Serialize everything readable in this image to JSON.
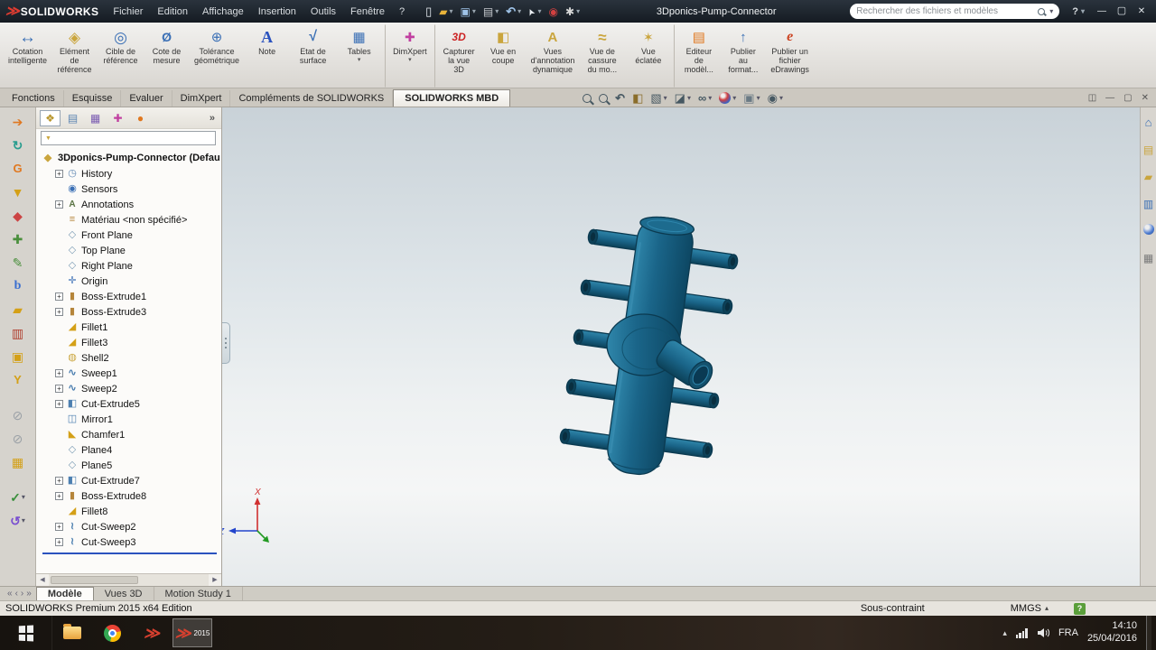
{
  "glyphs": {
    "plus": "+"
  },
  "titlebar": {
    "app_name": "SOLIDWORKS",
    "menus": [
      "Fichier",
      "Edition",
      "Affichage",
      "Insertion",
      "Outils",
      "Fenêtre",
      "?"
    ],
    "quick_icons": [
      {
        "icon": "new-file-icon"
      },
      {
        "icon": "open-folder-icon",
        "caret": "has-caret"
      },
      {
        "icon": "save-icon",
        "caret": "has-caret"
      },
      {
        "icon": "print-icon",
        "caret": "has-caret"
      },
      {
        "icon": "undo-icon",
        "caret": "has-caret"
      },
      {
        "icon": "select-cursor-icon",
        "caret": "has-caret"
      },
      {
        "icon": "rebuild-icon"
      },
      {
        "icon": "options-gear-icon",
        "caret": "has-caret"
      }
    ],
    "doc_title": "3Dponics-Pump-Connector",
    "search_placeholder": "Rechercher des fichiers et modèles",
    "help_label": "?",
    "window_controls": [
      {
        "icon": "minimize-icon"
      },
      {
        "icon": "maximize-icon"
      },
      {
        "icon": "close-icon"
      }
    ]
  },
  "ribbon": {
    "buttons": [
      {
        "label": "Cotation\nintelligente",
        "icon": "smart-dimension-icon"
      },
      {
        "label": "Elément\nde\nréférence",
        "icon": "reference-geometry-icon"
      },
      {
        "label": "Cible de\nréférence",
        "icon": "datum-target-icon"
      },
      {
        "label": "Cote de\nmesure",
        "icon": "measure-dimension-icon"
      },
      {
        "label": "Tolérance\ngéométrique",
        "icon": "geometric-tolerance-icon"
      },
      {
        "label": "Note",
        "icon": "note-icon"
      },
      {
        "label": "Etat de\nsurface",
        "icon": "surface-finish-icon"
      },
      {
        "label": "Tables",
        "icon": "tables-icon",
        "caret": "has-caret"
      },
      {
        "label": "DimXpert",
        "icon": "dimxpert-icon",
        "caret": "has-caret",
        "sep": "group-start"
      },
      {
        "label": "Capturer\nla vue\n3D",
        "icon": "capture-3d-view-icon",
        "sep": "group-start"
      },
      {
        "label": "Vue en\ncoupe",
        "icon": "section-view-icon"
      },
      {
        "label": "Vues\nd'annotation\ndynamique",
        "icon": "dynamic-annotation-icon"
      },
      {
        "label": "Vue de\ncassure\ndu mo...",
        "icon": "break-view-icon"
      },
      {
        "label": "Vue\néclatée",
        "icon": "exploded-view-icon"
      },
      {
        "label": "Editeur\nde\nmodèl...",
        "icon": "model-editor-icon",
        "sep": "group-start"
      },
      {
        "label": "Publier\nau\nformat...",
        "icon": "publish-format-icon"
      },
      {
        "label": "Publier un\nfichier\neDrawings",
        "icon": "edrawings-icon"
      }
    ]
  },
  "tabstrip": {
    "tabs": [
      {
        "label": "Fonctions"
      },
      {
        "label": "Esquisse"
      },
      {
        "label": "Evaluer"
      },
      {
        "label": "DimXpert"
      },
      {
        "label": "Compléments de SOLIDWORKS"
      },
      {
        "label": "SOLIDWORKS MBD",
        "state": "active"
      }
    ],
    "viewtools": [
      {
        "icon": "zoom-fit-icon"
      },
      {
        "icon": "zoom-area-icon"
      },
      {
        "icon": "previous-view-icon"
      },
      {
        "icon": "section-view-hud-icon"
      },
      {
        "icon": "view-orientation-icon",
        "caret": "has-caret"
      },
      {
        "icon": "display-style-icon",
        "caret": "has-caret"
      },
      {
        "icon": "hide-show-items-icon",
        "caret": "has-caret"
      },
      {
        "icon": "edit-appearance-icon",
        "caret": "has-caret"
      },
      {
        "icon": "apply-scene-icon",
        "caret": "has-caret"
      },
      {
        "icon": "view-settings-icon",
        "caret": "has-caret"
      }
    ],
    "window_icons": [
      {
        "icon": "viewport-split-icon"
      },
      {
        "icon": "minimize-doc-icon"
      },
      {
        "icon": "restore-doc-icon"
      },
      {
        "icon": "close-doc-icon"
      }
    ]
  },
  "left_toolbar": [
    {
      "icon": "export-arrow-icon"
    },
    {
      "icon": "refresh-tool-icon"
    },
    {
      "icon": "g-tool-icon"
    },
    {
      "icon": "down-arrow-tool-icon"
    },
    {
      "icon": "diamond-tool-icon"
    },
    {
      "icon": "plus-tool-icon"
    },
    {
      "icon": "pencil-tool-icon"
    },
    {
      "icon": "b-tool-icon"
    },
    {
      "icon": "folder-tool-icon"
    },
    {
      "icon": "book-tool-icon"
    },
    {
      "icon": "box-tool-icon"
    },
    {
      "icon": "y-tool-icon"
    },
    {
      "icon": "disabled-tool-icon",
      "sep": "gap-above"
    },
    {
      "icon": "disabled-tool-icon"
    },
    {
      "icon": "grid-tool-icon"
    },
    {
      "icon": "check-macro-icon",
      "caret": "has-caret",
      "sep": "gap-above"
    },
    {
      "icon": "rotate-macro-icon",
      "caret": "has-caret"
    }
  ],
  "feature_tree": {
    "header_tabs": [
      {
        "icon": "featuremanager-tab-icon",
        "state": "active"
      },
      {
        "icon": "propertymanager-tab-icon"
      },
      {
        "icon": "configurationmanager-tab-icon"
      },
      {
        "icon": "dimxpertmanager-tab-icon"
      },
      {
        "icon": "displaymanager-tab-icon"
      }
    ],
    "chevron": "»",
    "root_label": "3Dponics-Pump-Connector (Defau",
    "items": [
      {
        "label": "History",
        "icon": "history-icon",
        "plus": "has-plus"
      },
      {
        "label": "Sensors",
        "icon": "sensors-icon"
      },
      {
        "label": "Annotations",
        "icon": "annotations-icon",
        "plus": "has-plus"
      },
      {
        "label": "Matériau <non spécifié>",
        "icon": "material-icon"
      },
      {
        "label": "Front Plane",
        "icon": "plane-icon"
      },
      {
        "label": "Top Plane",
        "icon": "plane-icon"
      },
      {
        "label": "Right Plane",
        "icon": "plane-icon"
      },
      {
        "label": "Origin",
        "icon": "origin-icon"
      },
      {
        "label": "Boss-Extrude1",
        "icon": "boss-extrude-icon",
        "plus": "has-plus"
      },
      {
        "label": "Boss-Extrude3",
        "icon": "boss-extrude-icon",
        "plus": "has-plus"
      },
      {
        "label": "Fillet1",
        "icon": "fillet-icon"
      },
      {
        "label": "Fillet3",
        "icon": "fillet-icon"
      },
      {
        "label": "Shell2",
        "icon": "shell-icon"
      },
      {
        "label": "Sweep1",
        "icon": "sweep-icon",
        "plus": "has-plus"
      },
      {
        "label": "Sweep2",
        "icon": "sweep-icon",
        "plus": "has-plus"
      },
      {
        "label": "Cut-Extrude5",
        "icon": "cut-extrude-icon",
        "plus": "has-plus"
      },
      {
        "label": "Mirror1",
        "icon": "mirror-icon"
      },
      {
        "label": "Chamfer1",
        "icon": "chamfer-icon"
      },
      {
        "label": "Plane4",
        "icon": "plane-icon"
      },
      {
        "label": "Plane5",
        "icon": "plane-icon"
      },
      {
        "label": "Cut-Extrude7",
        "icon": "cut-extrude-icon",
        "plus": "has-plus"
      },
      {
        "label": "Boss-Extrude8",
        "icon": "boss-extrude-icon",
        "plus": "has-plus"
      },
      {
        "label": "Fillet8",
        "icon": "fillet-icon"
      },
      {
        "label": "Cut-Sweep2",
        "icon": "cut-sweep-icon",
        "plus": "has-plus"
      },
      {
        "label": "Cut-Sweep3",
        "icon": "cut-sweep-icon",
        "plus": "has-plus"
      }
    ]
  },
  "taskpane": [
    {
      "icon": "taskpane-resources-icon"
    },
    {
      "icon": "design-library-icon"
    },
    {
      "icon": "file-explorer-icon"
    },
    {
      "icon": "view-palette-icon"
    },
    {
      "icon": "appearances-icon"
    },
    {
      "icon": "custom-properties-icon"
    }
  ],
  "viewport": {
    "triad_x": "X",
    "triad_z": "Z",
    "part_color": "#1a6589"
  },
  "bottom_tabs": {
    "nav": [
      "«",
      "‹",
      "›",
      "»"
    ],
    "tabs": [
      {
        "label": "Modèle",
        "state": "active"
      },
      {
        "label": "Vues 3D"
      },
      {
        "label": "Motion Study 1"
      }
    ]
  },
  "statusbar": {
    "edition": "SOLIDWORKS Premium 2015 x64 Edition",
    "constraint": "Sous-contraint",
    "units": "MMGS"
  },
  "taskbar": {
    "lang": "FRA",
    "time": "14:10",
    "date": "25/04/2016",
    "sw_year": "2015"
  }
}
